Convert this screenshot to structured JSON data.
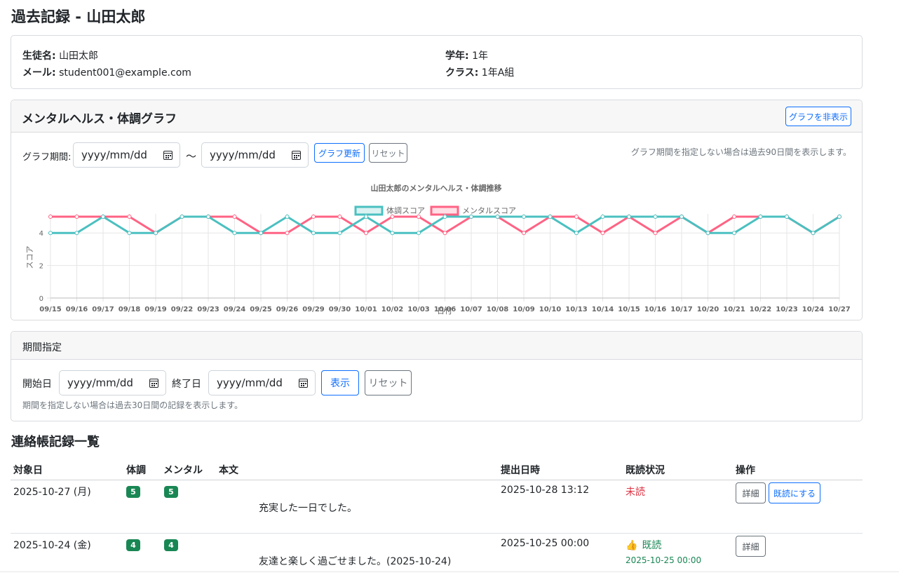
{
  "page": {
    "title": "過去記録 - 山田太郎"
  },
  "student": {
    "name_label": "生徒名:",
    "name": "山田太郎",
    "email_label": "メール:",
    "email": "student001@example.com",
    "grade_label": "学年:",
    "grade": "1年",
    "class_label": "クラス:",
    "class": "1年A組"
  },
  "graph_card": {
    "header": "メンタルヘルス・体調グラフ",
    "hide_button": "グラフを非表示",
    "period_label": "グラフ期間:",
    "start_placeholder": "yyyy/mm/dd",
    "tilde": "〜",
    "end_placeholder": "yyyy/mm/dd",
    "update_button": "グラフ更新",
    "reset_button": "リセット",
    "note": "グラフ期間を指定しない場合は過去90日間を表示します。"
  },
  "chart_data": {
    "type": "line",
    "title": "山田太郎のメンタルヘルス・体調推移",
    "xlabel": "日付",
    "ylabel": "スコア",
    "ylim": [
      0,
      5
    ],
    "y_ticks": [
      "0",
      "2",
      "4"
    ],
    "grid": true,
    "legend_position": "top",
    "categories": [
      "09/15",
      "09/16",
      "09/17",
      "09/18",
      "09/19",
      "09/22",
      "09/23",
      "09/24",
      "09/25",
      "09/26",
      "09/29",
      "09/30",
      "10/01",
      "10/02",
      "10/03",
      "10/06",
      "10/07",
      "10/08",
      "10/09",
      "10/10",
      "10/13",
      "10/14",
      "10/15",
      "10/16",
      "10/17",
      "10/20",
      "10/21",
      "10/22",
      "10/23",
      "10/24",
      "10/27"
    ],
    "series": [
      {
        "name": "体調スコア",
        "color": "#4bc0c0",
        "values": [
          4,
          4,
          5,
          4,
          4,
          5,
          5,
          4,
          4,
          5,
          4,
          4,
          5,
          4,
          4,
          5,
          5,
          5,
          5,
          5,
          4,
          5,
          5,
          5,
          5,
          4,
          4,
          5,
          5,
          4,
          5
        ]
      },
      {
        "name": "メンタルスコア",
        "color": "#ff6384",
        "values": [
          5,
          5,
          5,
          5,
          4,
          5,
          5,
          5,
          4,
          4,
          5,
          5,
          4,
          5,
          5,
          4,
          5,
          5,
          4,
          5,
          5,
          4,
          5,
          4,
          5,
          4,
          5,
          5,
          5,
          4,
          5
        ]
      }
    ]
  },
  "period_card": {
    "header": "期間指定",
    "start_label": "開始日",
    "start_placeholder": "yyyy/mm/dd",
    "end_label": "終了日",
    "end_placeholder": "yyyy/mm/dd",
    "show_button": "表示",
    "reset_button": "リセット",
    "note": "期間を指定しない場合は過去30日間の記録を表示します。"
  },
  "records": {
    "title": "連絡帳記録一覧",
    "columns": {
      "date": "対象日",
      "body": "体調",
      "mental": "メンタル",
      "text": "本文",
      "submitted": "提出日時",
      "read": "既読状況",
      "ops": "操作"
    },
    "rows": [
      {
        "date": "2025-10-27 (月)",
        "body": "5",
        "mental": "5",
        "text": "充実した一日でした。",
        "submitted": "2025-10-28 13:12",
        "read_status": "未読",
        "read_time": "",
        "detail": "詳細",
        "mark_read": "既読にする"
      },
      {
        "date": "2025-10-24 (金)",
        "body": "4",
        "mental": "4",
        "text": "友達と楽しく過ごせました。(2025-10-24)",
        "submitted": "2025-10-25 00:00",
        "read_icon": "👍",
        "read_status": "既読",
        "read_time": "2025-10-25 00:00",
        "detail": "詳細"
      }
    ]
  },
  "colors": {
    "primary": "#0d6efd",
    "success": "#198754",
    "danger": "#dc3545",
    "secondary": "#6c757d"
  }
}
